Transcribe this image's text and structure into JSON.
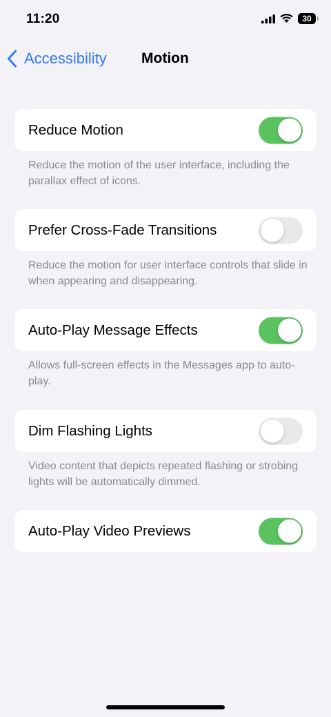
{
  "status_bar": {
    "time": "11:20",
    "battery": "30",
    "icons": [
      "signal-icon",
      "wifi-icon",
      "battery-icon"
    ]
  },
  "nav": {
    "back_label": "Accessibility",
    "title": "Motion",
    "accent_color": "#3478f6"
  },
  "settings": [
    {
      "label": "Reduce Motion",
      "on": true,
      "footnote": "Reduce the motion of the user interface, including the parallax effect of icons."
    },
    {
      "label": "Prefer Cross-Fade Transitions",
      "on": false,
      "footnote": "Reduce the motion for user interface controls that slide in when appearing and disappearing."
    },
    {
      "label": "Auto-Play Message Effects",
      "on": true,
      "footnote": "Allows full-screen effects in the Messages app to auto-play."
    },
    {
      "label": "Dim Flashing Lights",
      "on": false,
      "footnote": "Video content that depicts repeated flashing or strobing lights will be automatically dimmed."
    },
    {
      "label": "Auto-Play Video Previews",
      "on": true
    }
  ],
  "colors": {
    "toggle_on": "#5ac35f",
    "toggle_off": "#e9e9eb",
    "background": "#f2f2f7"
  }
}
